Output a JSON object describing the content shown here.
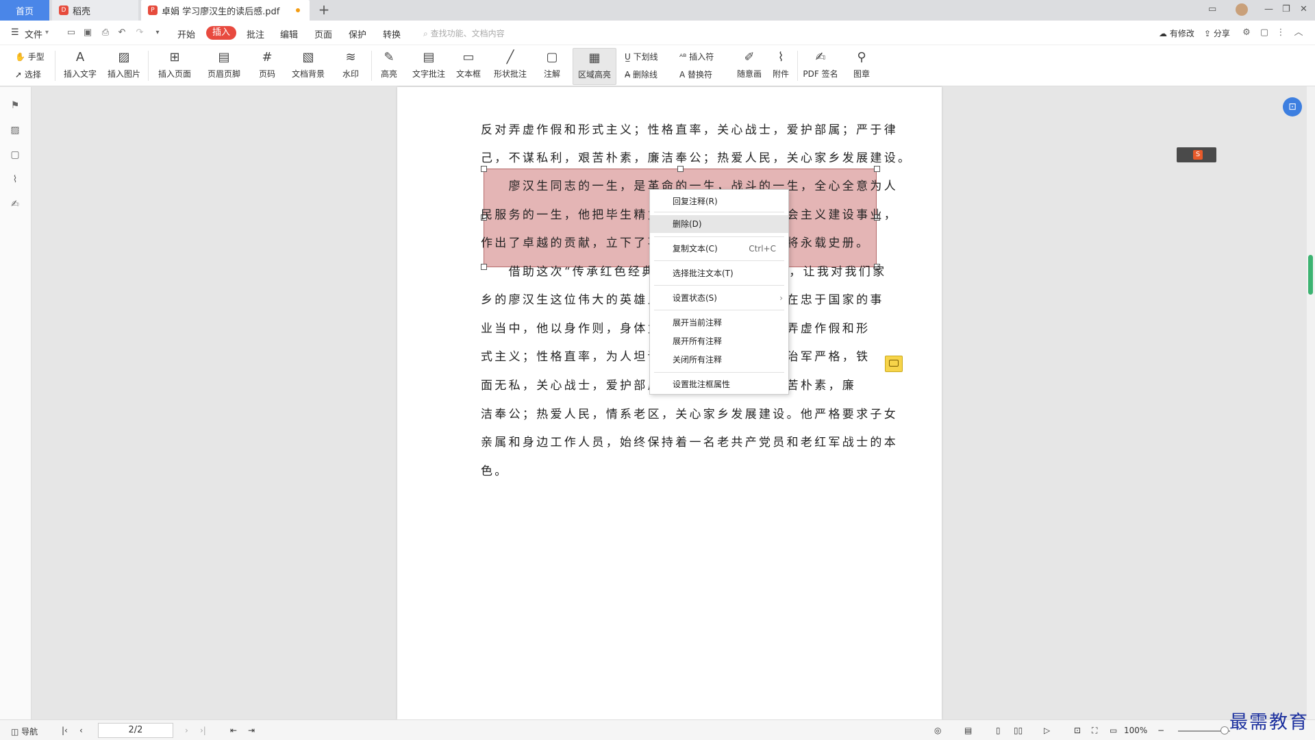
{
  "tabs": {
    "home": "首页",
    "draft": "稻壳",
    "doc": "卓娟 学习廖汉生的读后感.pdf"
  },
  "menu": {
    "file": "文件",
    "items": [
      "开始",
      "插入",
      "批注",
      "编辑",
      "页面",
      "保护",
      "转换"
    ],
    "active": "插入",
    "search_placeholder": "查找功能、文档内容",
    "modified": "有修改",
    "share": "分享"
  },
  "ribbon": {
    "hand": "手型",
    "select": "选择",
    "buttons": [
      "插入文字",
      "插入图片",
      "插入页面",
      "页眉页脚",
      "页码",
      "文档背景",
      "水印",
      "高亮",
      "文字批注",
      "文本框",
      "形状批注",
      "注解",
      "区域高亮",
      "随意画",
      "附件",
      "PDF 签名",
      "图章"
    ],
    "underline": "下划线",
    "insert_mark": "插入符",
    "strikethrough": "删除线",
    "replace_mark": "替换符"
  },
  "document": {
    "lines": [
      "反对弄虚作假和形式主义；性格直率，关心战士，爱护部属；严于律",
      "己，不谋私利，艰苦朴素，廉洁奉公；热爱人民，关心家乡发展建设。",
      "　　廖汉生同志的一生，是革命的一生，战斗的一生，全心全意为人",
      "民服务的一生，他把毕生精力献给了中国革命和社会主义建设事业，",
      "作出了卓越的贡献，立下了不朽的功勋，他的名字将永载史册。",
      "　　借助这次“传承红色经典，弘扬革命精神”活动，让我对我们家",
      "乡的廖汉生这位伟大的英雄人物有了更深的了解，在忠于国家的事",
      "业当中，他以身作则，身体力行，坚持原则，反对弄虚作假和形",
      "式主义；性格直率，为人坦诚，严于律己，对部下治军严格，铁",
      "面无私，关心战士，爱护部属；不谋私利，一生艰苦朴素，廉",
      "洁奉公；热爱人民，情系老区，关心家乡发展建设。他严格要求子女",
      "亲属和身边工作人员，始终保持着一名老共产党员和老红军战士的本",
      "色。"
    ]
  },
  "context_menu": {
    "items": [
      {
        "label": "回复注释(R)",
        "shortcut": ""
      },
      {
        "label": "删除(D)",
        "shortcut": ""
      },
      {
        "label": "复制文本(C)",
        "shortcut": "Ctrl+C"
      },
      {
        "label": "选择批注文本(T)",
        "shortcut": ""
      },
      {
        "label": "设置状态(S)",
        "shortcut": "›"
      },
      {
        "label": "展开当前注释",
        "shortcut": ""
      },
      {
        "label": "展开所有注释",
        "shortcut": ""
      },
      {
        "label": "关闭所有注释",
        "shortcut": ""
      },
      {
        "label": "设置批注框属性",
        "shortcut": ""
      }
    ]
  },
  "status": {
    "nav": "导航",
    "page": "2/2",
    "zoom": "100%"
  },
  "watermark": "最需教育"
}
